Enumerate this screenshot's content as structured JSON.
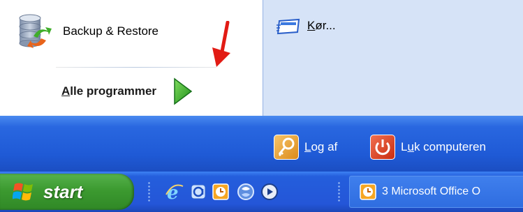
{
  "menu": {
    "pinned_item": {
      "label": "Backup & Restore",
      "icon": "backup-restore-icon"
    },
    "all_programs": {
      "label_first": "A",
      "label_rest": "lle programmer",
      "icon": "green-arrow-icon"
    },
    "right_items": [
      {
        "label_first": "K",
        "label_rest": "ør...",
        "icon": "run-icon"
      }
    ],
    "annotation": {
      "icon": "red-arrow-icon",
      "color": "#e21b14"
    }
  },
  "footer": {
    "logoff": {
      "label_first": "L",
      "label_rest": "og af",
      "icon": "key-icon"
    },
    "shutdown": {
      "label_first": "L",
      "label_mid": "u",
      "label_rest": "k computeren",
      "icon": "power-icon"
    }
  },
  "taskbar": {
    "start_label": "start",
    "quick_launch": [
      "internet-explorer-icon",
      "outlook-express-icon",
      "clock-icon",
      "media-player-icon",
      "quicktime-icon"
    ],
    "task": {
      "label": "3 Microsoft Office O",
      "icon": "clock-icon"
    }
  },
  "colors": {
    "footer_blue": "#2967e0",
    "taskbar_blue": "#245edc",
    "start_green": "#3c9a30",
    "right_panel": "#d6e3f7"
  }
}
